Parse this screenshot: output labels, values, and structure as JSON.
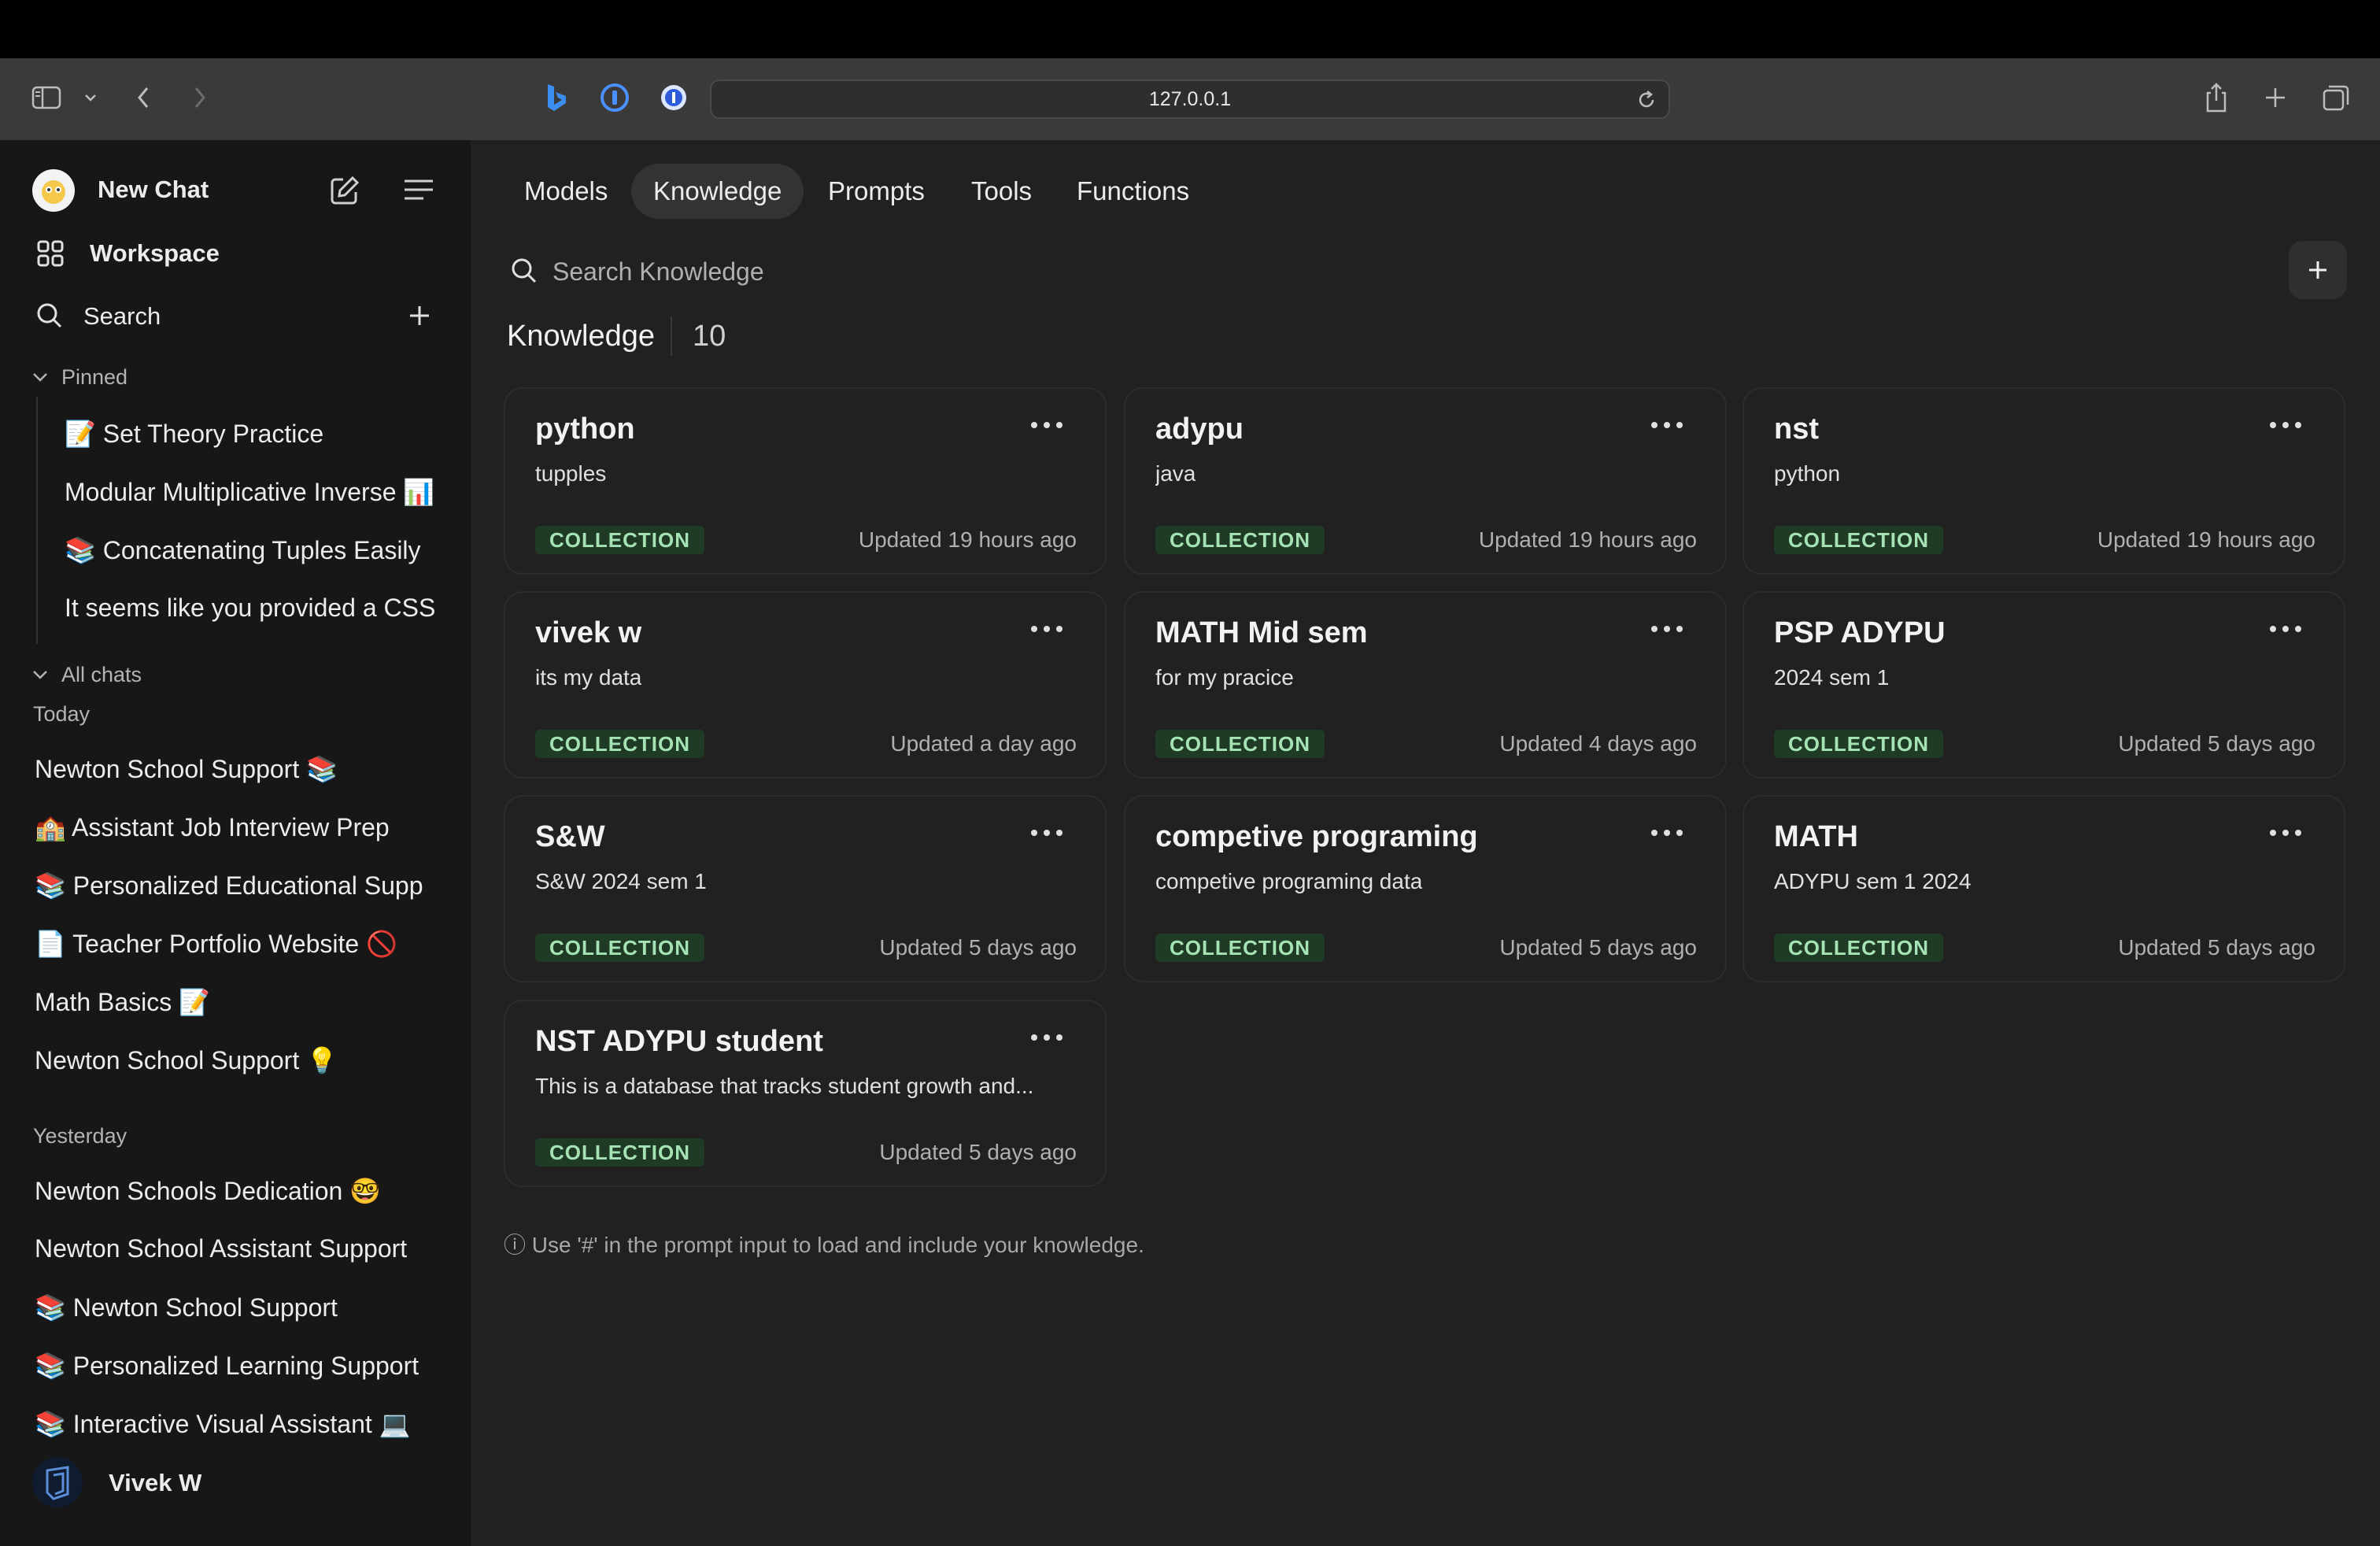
{
  "browser": {
    "url": "127.0.0.1",
    "icons": [
      "sidebar-toggle-icon",
      "chevron-down-icon",
      "back-icon",
      "forward-icon",
      "bing-icon",
      "onepassword-icon",
      "onepassword-alt-icon",
      "site-settings-icon",
      "reload-icon",
      "share-icon",
      "new-tab-icon",
      "tab-overview-icon"
    ]
  },
  "sidebar": {
    "new_chat": "New Chat",
    "workspace": "Workspace",
    "search": "Search",
    "pinned_label": "Pinned",
    "pinned": [
      "📝 Set Theory Practice",
      "Modular Multiplicative Inverse 📊",
      "📚 Concatenating Tuples Easily",
      "It seems like you provided a CSS"
    ],
    "all_chats_label": "All chats",
    "today_label": "Today",
    "today": [
      "Newton School Support 📚",
      "🏫 Assistant Job Interview Prep",
      "📚 Personalized Educational Supp",
      "📄 Teacher Portfolio Website 🚫",
      "Math Basics 📝",
      "Newton School Support 💡"
    ],
    "yesterday_label": "Yesterday",
    "yesterday": [
      "Newton Schools Dedication 🤓",
      "Newton School Assistant Support",
      "📚 Newton School Support",
      "📚 Personalized Learning Support",
      "📚 Interactive Visual Assistant 💻"
    ],
    "user_name": "Vivek W"
  },
  "tabs": [
    "Models",
    "Knowledge",
    "Prompts",
    "Tools",
    "Functions"
  ],
  "active_tab": "Knowledge",
  "search": {
    "placeholder": "Search Knowledge"
  },
  "heading": {
    "title": "Knowledge",
    "count": "10"
  },
  "cards": [
    {
      "title": "python",
      "desc": "tupples",
      "badge": "COLLECTION",
      "updated": "Updated 19 hours ago"
    },
    {
      "title": "adypu",
      "desc": "java",
      "badge": "COLLECTION",
      "updated": "Updated 19 hours ago"
    },
    {
      "title": "nst",
      "desc": "python",
      "badge": "COLLECTION",
      "updated": "Updated 19 hours ago"
    },
    {
      "title": "vivek w",
      "desc": "its my data",
      "badge": "COLLECTION",
      "updated": "Updated a day ago"
    },
    {
      "title": "MATH Mid sem",
      "desc": "for my pracice",
      "badge": "COLLECTION",
      "updated": "Updated 4 days ago"
    },
    {
      "title": "PSP ADYPU",
      "desc": "2024 sem 1",
      "badge": "COLLECTION",
      "updated": "Updated 5 days ago"
    },
    {
      "title": "S&W",
      "desc": "S&W 2024 sem 1",
      "badge": "COLLECTION",
      "updated": "Updated 5 days ago"
    },
    {
      "title": "competive programing",
      "desc": "competive programing data",
      "badge": "COLLECTION",
      "updated": "Updated 5 days ago"
    },
    {
      "title": "MATH",
      "desc": "ADYPU sem 1 2024",
      "badge": "COLLECTION",
      "updated": "Updated 5 days ago"
    },
    {
      "title": "NST ADYPU student",
      "desc": "This is a database that tracks student growth and...",
      "badge": "COLLECTION",
      "updated": "Updated 5 days ago"
    }
  ],
  "footer_hint": "ⓘ Use '#' in the prompt input to load and include your knowledge.",
  "colors": {
    "sidebar_bg": "#171717",
    "main_bg": "#212121",
    "badge_bg": "#1f3b26",
    "badge_text": "#a6e3b4"
  }
}
